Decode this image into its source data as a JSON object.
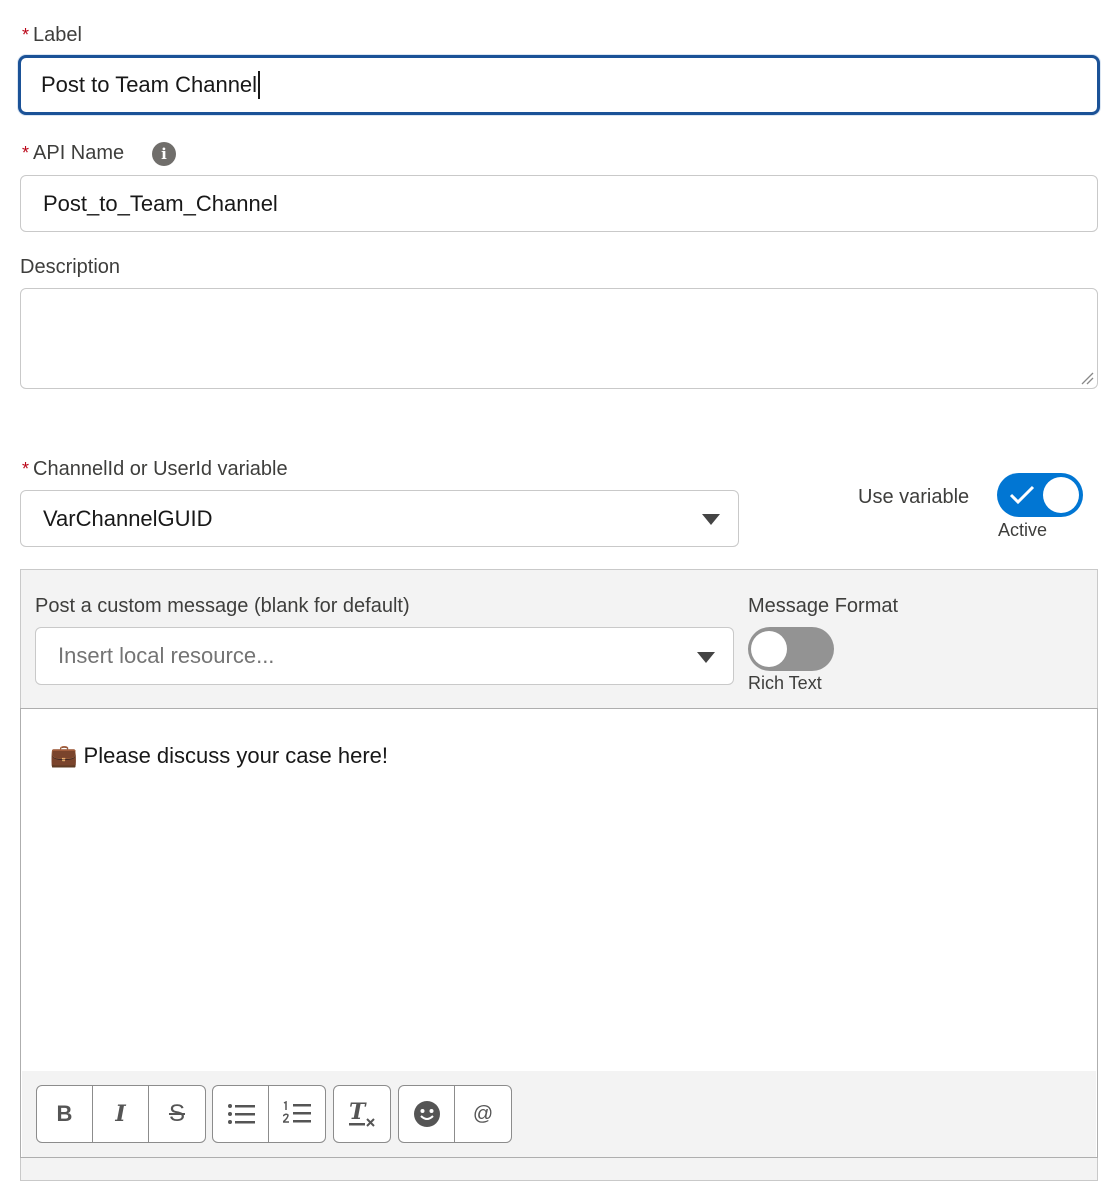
{
  "label_field": {
    "label": "Label",
    "value": "Post to Team Channel",
    "required_mark": "*"
  },
  "api_name_field": {
    "label": "API Name",
    "value": "Post_to_Team_Channel",
    "required_mark": "*",
    "info_glyph": "i"
  },
  "description_field": {
    "label": "Description",
    "value": ""
  },
  "channel_field": {
    "label": "ChannelId or UserId variable",
    "value": "VarChannelGUID",
    "required_mark": "*"
  },
  "use_variable": {
    "label": "Use variable",
    "state_text": "Active",
    "on": true
  },
  "custom_message": {
    "label": "Post a custom message (blank for default)",
    "placeholder": "Insert local resource..."
  },
  "message_format": {
    "label": "Message Format",
    "state_text": "Rich Text",
    "on": false
  },
  "editor": {
    "emoji": "💼",
    "text": "Please discuss your case here!"
  },
  "toolbar": {
    "bold": "B",
    "italic": "I",
    "strike": "S",
    "icons": [
      "bold-icon",
      "italic-icon",
      "strikethrough-icon",
      "bulleted-list-icon",
      "numbered-list-icon",
      "clear-format-icon",
      "emoji-icon",
      "mention-icon"
    ],
    "mention": "@"
  },
  "colors": {
    "accent": "#0176d3",
    "focus_border": "#1b5297",
    "required": "#ba0517",
    "toggle_off": "#939393"
  }
}
